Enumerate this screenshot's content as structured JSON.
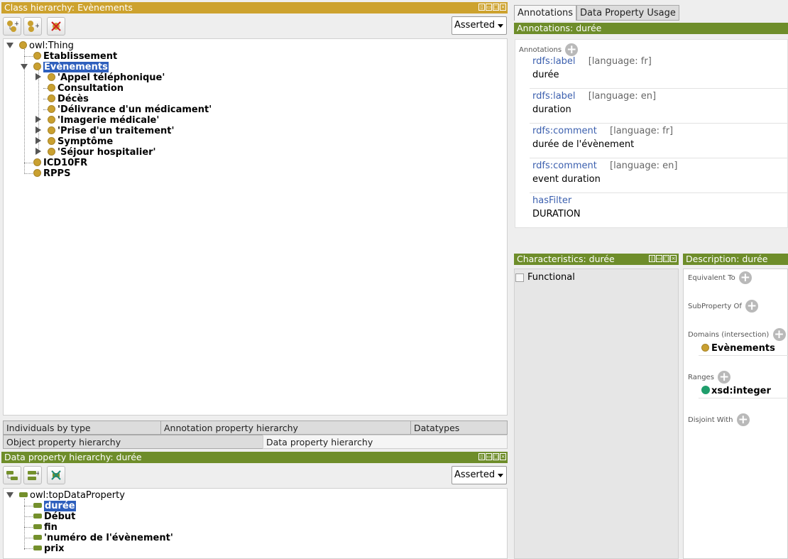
{
  "class_hierarchy": {
    "title": "Class hierarchy: Evènements",
    "mode_select": "Asserted",
    "root": "owl:Thing",
    "items": [
      {
        "label": "Etablissement",
        "level": 1
      },
      {
        "label": "Evènements",
        "level": 1,
        "selected": true,
        "expanded": true
      },
      {
        "label": "'Appel téléphonique'",
        "level": 2,
        "expandable": true
      },
      {
        "label": "Consultation",
        "level": 2
      },
      {
        "label": "Décès",
        "level": 2
      },
      {
        "label": "'Délivrance d'un médicament'",
        "level": 2
      },
      {
        "label": "'Imagerie médicale'",
        "level": 2,
        "expandable": true
      },
      {
        "label": "'Prise d'un traitement'",
        "level": 2,
        "expandable": true
      },
      {
        "label": "Symptôme",
        "level": 2,
        "expandable": true
      },
      {
        "label": "'Séjour hospitalier'",
        "level": 2,
        "expandable": true
      },
      {
        "label": "ICD10FR",
        "level": 1
      },
      {
        "label": "RPPS",
        "level": 1
      }
    ]
  },
  "bottom_tabs": {
    "row1": [
      "Individuals by type",
      "Annotation property hierarchy",
      "Datatypes"
    ],
    "row2": [
      "Object property hierarchy",
      "Data property hierarchy"
    ],
    "active": "Data property hierarchy"
  },
  "data_property_hierarchy": {
    "title": "Data property hierarchy: durée",
    "mode_select": "Asserted",
    "root": "owl:topDataProperty",
    "items": [
      {
        "label": "durée",
        "selected": true
      },
      {
        "label": "Début"
      },
      {
        "label": "fin"
      },
      {
        "label": "'numéro de l'évènement'"
      },
      {
        "label": "prix"
      }
    ]
  },
  "right_tabs": [
    "Annotations",
    "Data Property Usage"
  ],
  "annotations": {
    "title": "Annotations: durée",
    "section_label": "Annotations",
    "entries": [
      {
        "property": "rdfs:label",
        "lang": "[language: fr]",
        "value": "durée"
      },
      {
        "property": "rdfs:label",
        "lang": "[language: en]",
        "value": "duration"
      },
      {
        "property": "rdfs:comment",
        "lang": "[language: fr]",
        "value": "durée de l'évènement"
      },
      {
        "property": "rdfs:comment",
        "lang": "[language: en]",
        "value": "event duration"
      },
      {
        "property": "hasFilter",
        "lang": "",
        "value": "DURATION"
      }
    ]
  },
  "characteristics": {
    "title": "Characteristics: durée",
    "functional_label": "Functional",
    "functional_checked": false
  },
  "description": {
    "title": "Description: durée",
    "equivalent_to": "Equivalent To",
    "subproperty_of": "SubProperty Of",
    "domains_label": "Domains (intersection)",
    "domain_value": "Evènements",
    "ranges_label": "Ranges",
    "range_value": "xsd:integer",
    "disjoint_with": "Disjoint With"
  },
  "colors": {
    "class_title_bar": "#cda22e",
    "property_title_bar": "#6e8d2a",
    "selection": "#2e5fbd",
    "class_icon": "#c9a030",
    "datatype_icon": "#1f9e6c",
    "data_property_icon": "#74902c"
  }
}
